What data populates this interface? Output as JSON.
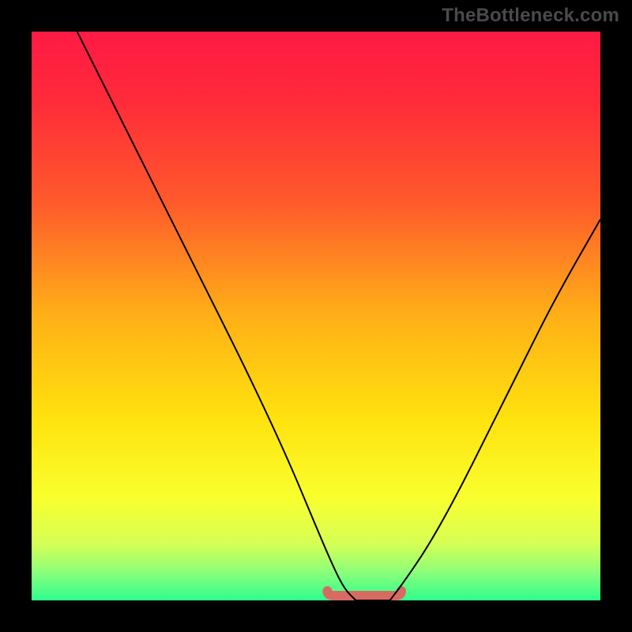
{
  "watermark": "TheBottleneck.com",
  "colors": {
    "black": "#000000",
    "watermark": "#4a4a4a",
    "curve": "#000000",
    "marker": "#d86a64",
    "gradient_stops": [
      {
        "offset": 0.0,
        "color": "#ff1a44"
      },
      {
        "offset": 0.12,
        "color": "#ff2a3a"
      },
      {
        "offset": 0.3,
        "color": "#ff5a2b"
      },
      {
        "offset": 0.5,
        "color": "#ffb017"
      },
      {
        "offset": 0.68,
        "color": "#ffe20e"
      },
      {
        "offset": 0.82,
        "color": "#f9ff2e"
      },
      {
        "offset": 0.9,
        "color": "#d6ff55"
      },
      {
        "offset": 0.95,
        "color": "#8cff7a"
      },
      {
        "offset": 1.0,
        "color": "#2dff8c"
      }
    ]
  },
  "chart_data": {
    "type": "line",
    "title": "",
    "xlabel": "",
    "ylabel": "",
    "xlim": [
      0,
      100
    ],
    "ylim": [
      0,
      100
    ],
    "note": "x roughly maps to horizontal position (0–100 left→right); y roughly maps to vertical value where 0 is the bottom green band and 100 is the top. The minimum (bottleneck) lies around x≈55–63 at y≈0.",
    "series": [
      {
        "name": "left-branch",
        "x": [
          8,
          15,
          22,
          30,
          38,
          45,
          50,
          53,
          55,
          57
        ],
        "values": [
          100,
          86,
          72,
          56,
          40,
          25,
          13,
          6,
          2,
          0
        ]
      },
      {
        "name": "flat-bottom",
        "x": [
          57,
          58,
          59,
          60,
          61,
          62,
          63
        ],
        "values": [
          0,
          0,
          0,
          0,
          0,
          0,
          0
        ]
      },
      {
        "name": "right-branch",
        "x": [
          63,
          66,
          70,
          75,
          80,
          86,
          92,
          100
        ],
        "values": [
          0,
          4,
          10,
          19,
          29,
          41,
          53,
          67
        ]
      }
    ],
    "marker": {
      "name": "bottom-highlight",
      "shape": "rounded-segment",
      "x_range": [
        52,
        65
      ],
      "y": 0
    }
  }
}
